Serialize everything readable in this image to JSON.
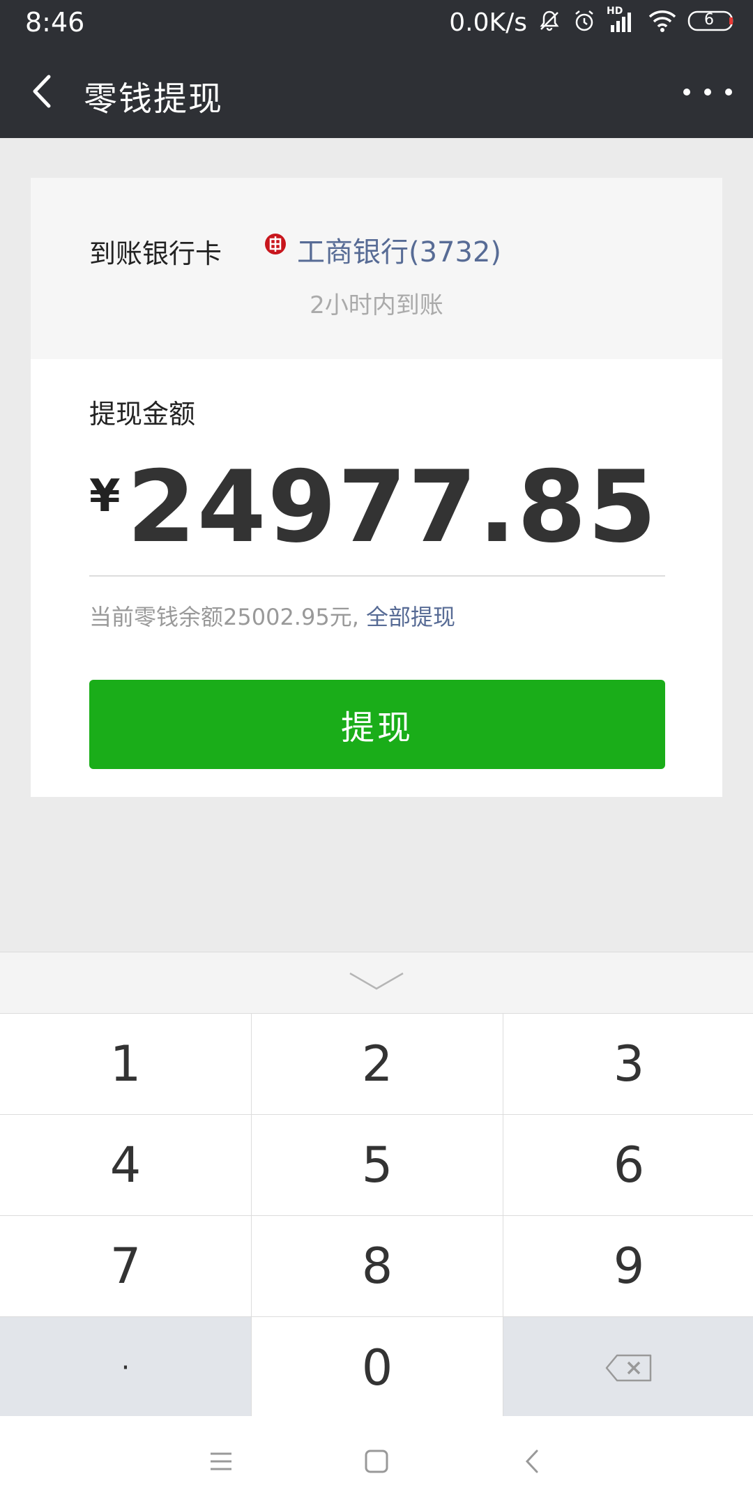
{
  "status_bar": {
    "time": "8:46",
    "net_speed": "0.0K/s",
    "network_badge": "HD",
    "battery": "6"
  },
  "app_bar": {
    "title": "零钱提现"
  },
  "bank_card": {
    "label": "到账银行卡",
    "bank_name": "工商银行(3732)",
    "arrival_hint": "2小时内到账",
    "bank_logo_color": "#c8161d"
  },
  "amount": {
    "label": "提现金额",
    "currency_symbol": "¥",
    "value": "24977.85"
  },
  "balance": {
    "text": "当前零钱余额25002.95元,",
    "withdraw_all_link": "全部提现"
  },
  "withdraw_button": {
    "label": "提现",
    "color": "#1aad19"
  },
  "keypad": {
    "keys": [
      "1",
      "2",
      "3",
      "4",
      "5",
      "6",
      "7",
      "8",
      "9",
      "·",
      "0"
    ]
  },
  "colors": {
    "header_bg": "#2e3035",
    "link": "#576b95",
    "page_bg": "#ebebeb"
  }
}
